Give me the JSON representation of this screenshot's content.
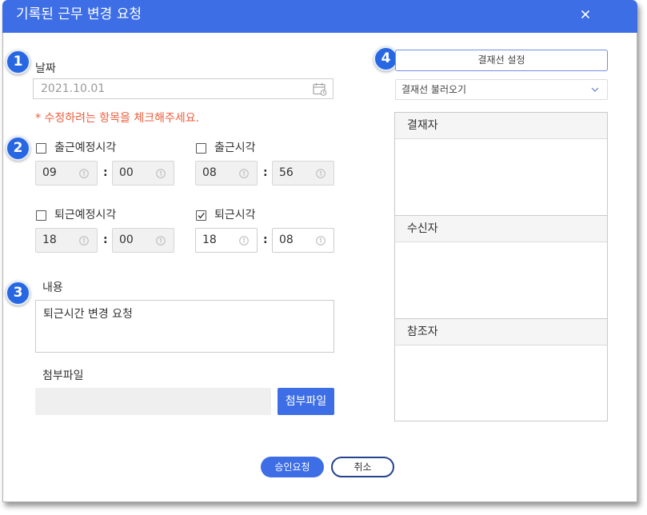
{
  "dialog": {
    "title": "기록된 근무 변경 요청"
  },
  "steps": {
    "date": "1",
    "times": "2",
    "content": "3",
    "approval": "4"
  },
  "date": {
    "label": "날짜",
    "value": "2021.10.01"
  },
  "notice": "* 수정하려는 항목을 체크해주세요.",
  "time_separator": ":",
  "time_groups": [
    {
      "label": "출근예정시각",
      "checked": false,
      "hour": "09",
      "minute": "00"
    },
    {
      "label": "출근시각",
      "checked": false,
      "hour": "08",
      "minute": "56"
    },
    {
      "label": "퇴근예정시각",
      "checked": false,
      "hour": "18",
      "minute": "00"
    },
    {
      "label": "퇴근시각",
      "checked": true,
      "hour": "18",
      "minute": "08"
    }
  ],
  "content": {
    "label": "내용",
    "value": "퇴근시간 변경 요청"
  },
  "attachment": {
    "label": "첨부파일",
    "button_label": "첨부파일"
  },
  "approval": {
    "setup_button_label": "결재선 설정",
    "load_select_value": "결재선 불러오기",
    "sections": [
      {
        "title": "결재자"
      },
      {
        "title": "수신자"
      },
      {
        "title": "참조자"
      }
    ]
  },
  "actions": {
    "submit_label": "승인요청",
    "cancel_label": "취소"
  },
  "colors": {
    "primary": "#3d6ee6",
    "badge": "#2767e2",
    "notice": "#f05c3b",
    "navy": "#24438f"
  },
  "icons": {
    "close": "close-icon",
    "calendar": "calendar-icon",
    "clock": "clock-icon",
    "chevron": "chevron-down-icon",
    "check": "checkmark-icon"
  }
}
